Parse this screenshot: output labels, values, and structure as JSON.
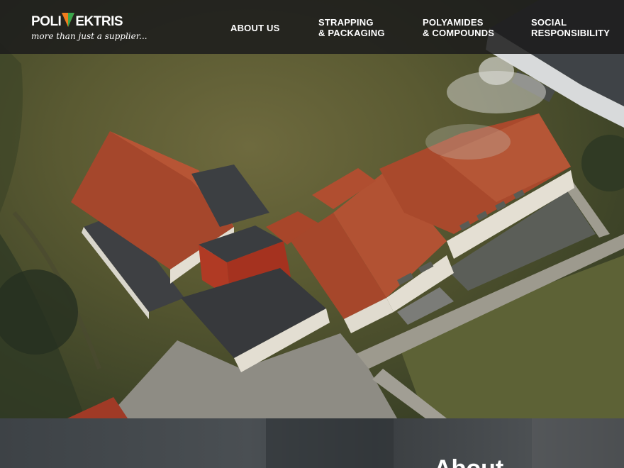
{
  "brand": {
    "name_left": "POLI",
    "name_right": "EKTRIS",
    "tagline": "more than just a supplier...",
    "colors": {
      "orange": "#f07d1e",
      "green": "#3aa64c"
    }
  },
  "nav": {
    "items": [
      {
        "line1": "ABOUT US",
        "line2": ""
      },
      {
        "line1": "STRAPPING",
        "line2": "& PACKAGING"
      },
      {
        "line1": "POLYAMIDES",
        "line2": "& COMPOUNDS"
      },
      {
        "line1": "SOCIAL",
        "line2": "RESPONSIBILITY"
      }
    ]
  },
  "hero": {
    "image": "aerial-photo-of-company-headquarters-buildings"
  },
  "section": {
    "heading": "About"
  }
}
